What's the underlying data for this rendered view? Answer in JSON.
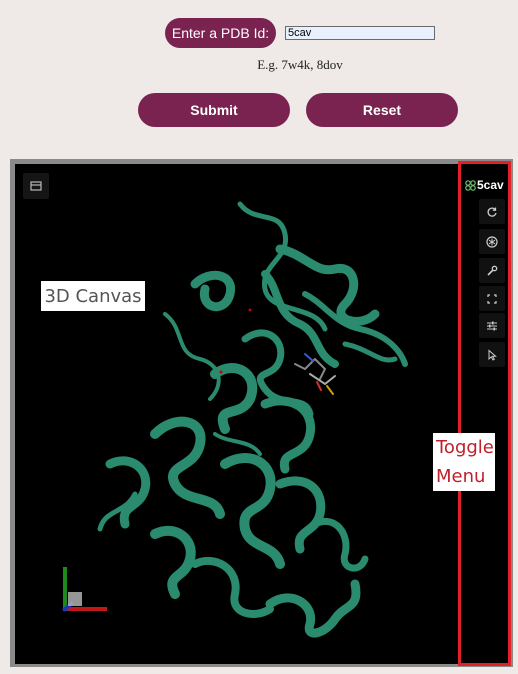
{
  "form": {
    "pdb_label": "Enter a PDB Id:",
    "pdb_value": "5cav",
    "example_text": "E.g. 7w4k, 8dov",
    "submit_label": "Submit",
    "reset_label": "Reset"
  },
  "viewer": {
    "molecule_id": "5cav",
    "canvas_annotation": "3D Canvas",
    "menu_annotation_line1": "Toggle",
    "menu_annotation_line2": "Menu",
    "tools": [
      "rotate-icon",
      "molecule-style-icon",
      "wrench-icon",
      "fullscreen-icon",
      "settings-sliders-icon",
      "select-cursor-icon"
    ]
  },
  "colors": {
    "accent": "#7b2350",
    "viewer_bg": "#000000",
    "ribbon": "#2a8b6e",
    "annotation_red": "#e1202a"
  }
}
